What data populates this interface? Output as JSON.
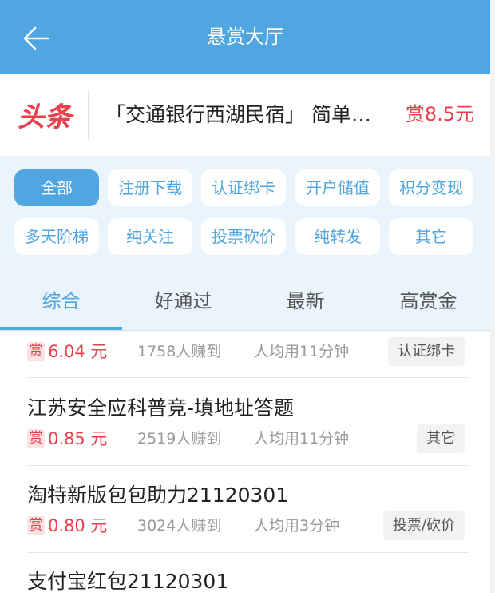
{
  "header": {
    "title": "悬赏大厅",
    "back_icon": "arrow-left-icon"
  },
  "headline": {
    "logo_text": "头条",
    "news_text": "「交通银行西湖民宿」 简单…",
    "reward": "赏8.5元"
  },
  "filters": {
    "items": [
      "全部",
      "注册下载",
      "认证绑卡",
      "开户储值",
      "积分变现",
      "多天阶梯",
      "纯关注",
      "投票砍价",
      "纯转发",
      "其它"
    ],
    "active": "全部"
  },
  "tabs": {
    "items": [
      "综合",
      "好通过",
      "最新",
      "高赏金"
    ],
    "active": "综合"
  },
  "tasks": [
    {
      "name": "",
      "shang": "赏",
      "amount": "6.04 元",
      "earned": "1758人赚到",
      "avg": "人均用11分钟",
      "category": "认证绑卡"
    },
    {
      "name": "江苏安全应科普竞-填地址答题",
      "shang": "赏",
      "amount": "0.85 元",
      "earned": "2519人赚到",
      "avg": "人均用11分钟",
      "category": "其它"
    },
    {
      "name": "淘特新版包包助力21120301",
      "shang": "赏",
      "amount": "0.80 元",
      "earned": "3024人赚到",
      "avg": "人均用3分钟",
      "category": "投票/砍价"
    },
    {
      "name": "支付宝红包21120301"
    }
  ],
  "colors": {
    "primary": "#4fa6e0",
    "reward": "#e8414c",
    "filter_bg": "#e9f4fd"
  }
}
